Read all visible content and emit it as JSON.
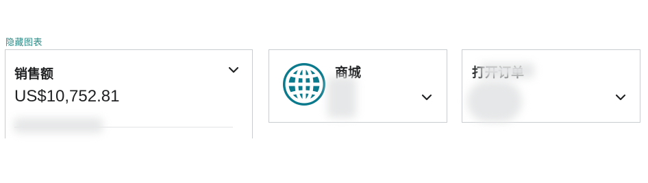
{
  "header": {
    "hide_charts_label": "隐藏图表"
  },
  "cards": {
    "sales": {
      "title": "销售额",
      "value": "US$10,752.81",
      "icon": "chevron-down-icon"
    },
    "store": {
      "title": "商城",
      "icon": "globe-icon",
      "accent_color": "#0b7a8c"
    },
    "open_orders": {
      "title": "打开订单",
      "icon": "chevron-down-icon"
    }
  }
}
